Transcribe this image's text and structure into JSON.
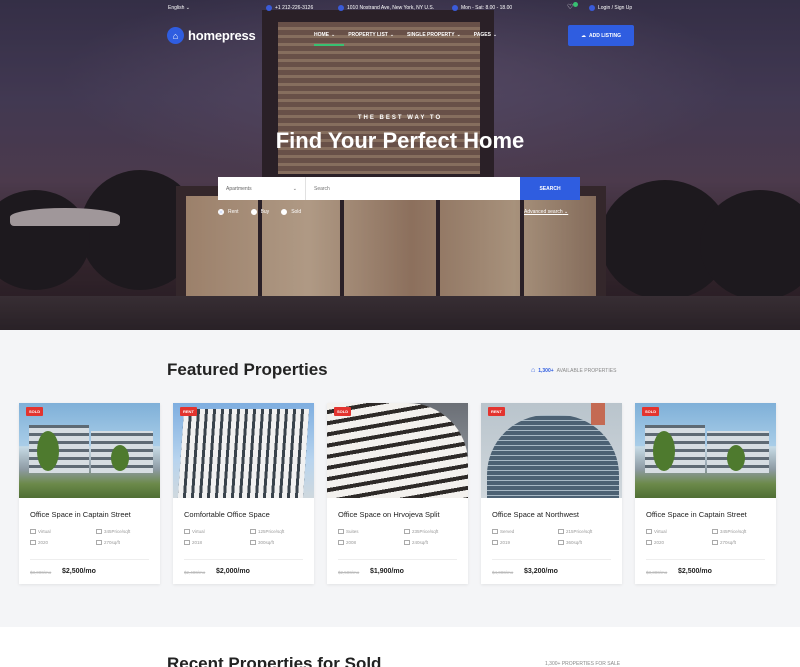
{
  "topbar": {
    "language": "English",
    "phone": "+1 212-226-3126",
    "address": "1010 Nostrand Ave, New York, NY U.S.",
    "hours": "Mon - Sat: 8.00 - 18.00",
    "login": "Login / Sign Up"
  },
  "nav": {
    "logo": "homepress",
    "items": [
      "HOME",
      "PROPERTY LIST",
      "SINGLE PROPERTY",
      "PAGES"
    ],
    "add_listing": "ADD LISTING"
  },
  "hero": {
    "subtitle": "THE BEST WAY TO",
    "title": "Find Your Perfect Home",
    "select_value": "Apartments",
    "search_placeholder": "Search",
    "search_button": "SEARCH",
    "radios": [
      "Rent",
      "Buy",
      "Sold"
    ],
    "advanced": "Advanced search"
  },
  "featured": {
    "title": "Featured Properties",
    "available_count": "1,300+",
    "available_label": "AVAILABLE PROPERTIES",
    "cards": [
      {
        "badge": "SOLD",
        "title": "Office Space in Captain Street",
        "m1": "Virtual",
        "m2": "345Price/sqft",
        "m3": "2020",
        "m4": "270sq/ft",
        "old": "$3,000/mo",
        "price": "$2,500/mo"
      },
      {
        "badge": "RENT",
        "title": "Comfortable Office Space",
        "m1": "Virtual",
        "m2": "125Price/sqft",
        "m3": "2018",
        "m4": "300sq/ft",
        "old": "$2,400/mo",
        "price": "$2,000/mo"
      },
      {
        "badge": "SOLD",
        "title": "Office Space on Hrvojeva Split",
        "m1": "Suites",
        "m2": "235Price/sqft",
        "m3": "2008",
        "m4": "240sq/ft",
        "old": "$2,500/mo",
        "price": "$1,900/mo"
      },
      {
        "badge": "RENT",
        "title": "Office Space at Northwest",
        "m1": "Served",
        "m2": "215Price/sqft",
        "m3": "2019",
        "m4": "360sq/ft",
        "old": "$4,000/mo",
        "price": "$3,200/mo"
      },
      {
        "badge": "SOLD",
        "title": "Office Space in Captain Street",
        "m1": "Virtual",
        "m2": "345Price/sqft",
        "m3": "2020",
        "m4": "270sq/ft",
        "old": "$3,300/mo",
        "price": "$2,500/mo"
      }
    ]
  },
  "recent": {
    "title": "Recent Properties for Sold",
    "meta": "1,300+ PROPERTIES FOR SALE"
  },
  "colors": {
    "accent": "#2f5de0",
    "badge": "#e3342f",
    "active_underline": "#38c172"
  }
}
